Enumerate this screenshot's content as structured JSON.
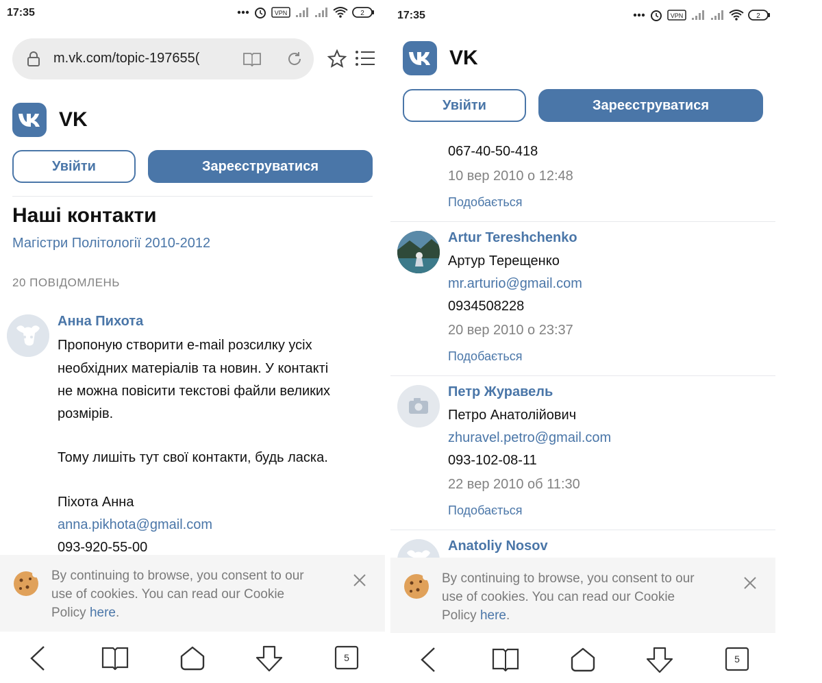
{
  "status": {
    "time": "17:35",
    "vpn": "VPN",
    "battery": "2"
  },
  "browser": {
    "url": "m.vk.com/topic-197655(",
    "tabs_count": "5"
  },
  "vk": {
    "name": "VK",
    "logo": "vk-logo",
    "login_label": "Увійти",
    "register_label": "Зареєструватися"
  },
  "topic": {
    "title": "Наші контакти",
    "group": "Магістри Політології 2010-2012",
    "count": "20 ПОВІДОМЛЕНЬ"
  },
  "left_post": {
    "author": "Анна Пихота",
    "lines": [
      "Пропоную створити e-mail розсилку усіх",
      "необхідних матеріалів та новин. У контакті",
      "не можна повісити текстові файли великих",
      "розмірів.",
      "Тому лишіть тут свої контакти, будь ласка.",
      "Піхота Анна"
    ],
    "email": "anna.pikhota@gmail.com",
    "phone": "093-920-55-00"
  },
  "right_posts": {
    "partial": {
      "phone": "067-40-50-418",
      "date": "10 вер 2010 о 12:48",
      "like": "Подобається"
    },
    "post1": {
      "author": "Artur Tereshchenko",
      "name": "Артур Терещенко",
      "email": "mr.arturio@gmail.com",
      "phone": "0934508228",
      "date": "20 вер 2010 о 23:37",
      "like": "Подобається"
    },
    "post2": {
      "author": "Петр Журавель",
      "name": "Петро Анатолійович",
      "email": "zhuravel.petro@gmail.com",
      "phone": "093-102-08-11",
      "date": "22 вер 2010 об 11:30",
      "like": "Подобається"
    },
    "post3": {
      "author": "Anatoliy Nosov"
    }
  },
  "cookie": {
    "line1": "By continuing to browse, you consent to our",
    "line2": "use of cookies. You can read our Cookie",
    "line3": "Policy ",
    "link": "here",
    "period": "."
  },
  "colors": {
    "accent": "#4a76a8",
    "muted": "#828282",
    "banner_bg": "#f5f5f5"
  },
  "icons": [
    "lock-icon",
    "reader-icon",
    "reload-icon",
    "star-icon",
    "menu-icon",
    "cookie-icon",
    "close-icon",
    "back-icon",
    "bookmarks-icon",
    "home-icon",
    "download-icon",
    "tabs-icon",
    "camera-icon",
    "alarm-icon",
    "signal-icon",
    "wifi-icon",
    "battery-icon"
  ]
}
